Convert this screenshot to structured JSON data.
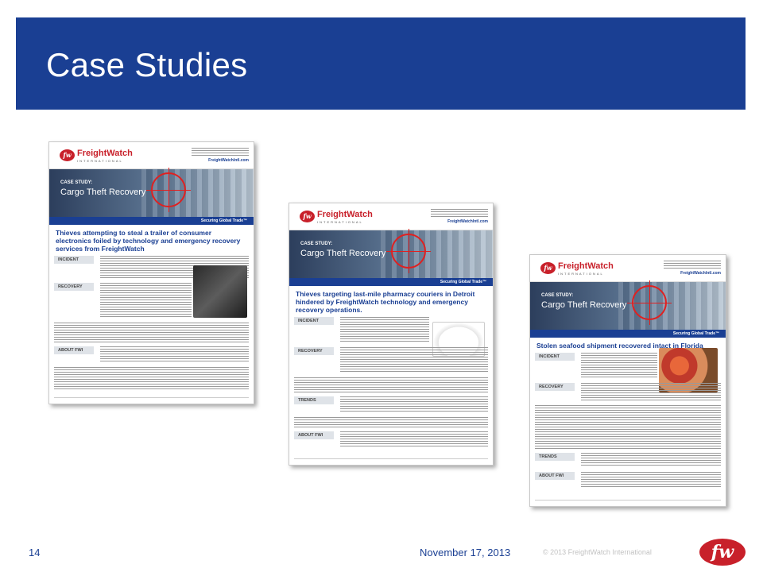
{
  "slide": {
    "title": "Case Studies",
    "page_number": "14",
    "date": "November 17, 2013",
    "copyright": "© 2013 FreightWatch International",
    "logo_text": "fw",
    "accent_color": "#1a3f93",
    "brand_color": "#c8202a"
  },
  "documents": [
    {
      "brand": "FreightWatch",
      "brand_sub": "INTERNATIONAL",
      "website": "FreightWatchIntl.com",
      "case_label": "CASE STUDY:",
      "case_title": "Cargo Theft Recovery",
      "tagline": "Securing Global Trade™",
      "headline": "Thieves attempting to steal a trailer of consumer electronics foiled by technology and emergency recovery services from FreightWatch",
      "sections": [
        "INCIDENT",
        "RECOVERY",
        "ABOUT FWI"
      ],
      "image_icon": "electronics-photo"
    },
    {
      "brand": "FreightWatch",
      "brand_sub": "INTERNATIONAL",
      "website": "FreightWatchIntl.com",
      "case_label": "CASE STUDY:",
      "case_title": "Cargo Theft Recovery",
      "tagline": "Securing Global Trade™",
      "headline": "Thieves targeting last-mile pharmacy couriers in Detroit hindered by FreightWatch technology and emergency recovery operations.",
      "sections": [
        "INCIDENT",
        "RECOVERY",
        "TRENDS",
        "ABOUT FWI"
      ],
      "image_icon": "van-photo"
    },
    {
      "brand": "FreightWatch",
      "brand_sub": "INTERNATIONAL",
      "website": "FreightWatchIntl.com",
      "case_label": "CASE STUDY:",
      "case_title": "Cargo Theft Recovery",
      "tagline": "Securing Global Trade™",
      "headline": "Stolen seafood shipment recovered intact in Florida",
      "sections": [
        "INCIDENT",
        "RECOVERY",
        "TRENDS",
        "ABOUT FWI"
      ],
      "image_icon": "seafood-photo"
    }
  ]
}
